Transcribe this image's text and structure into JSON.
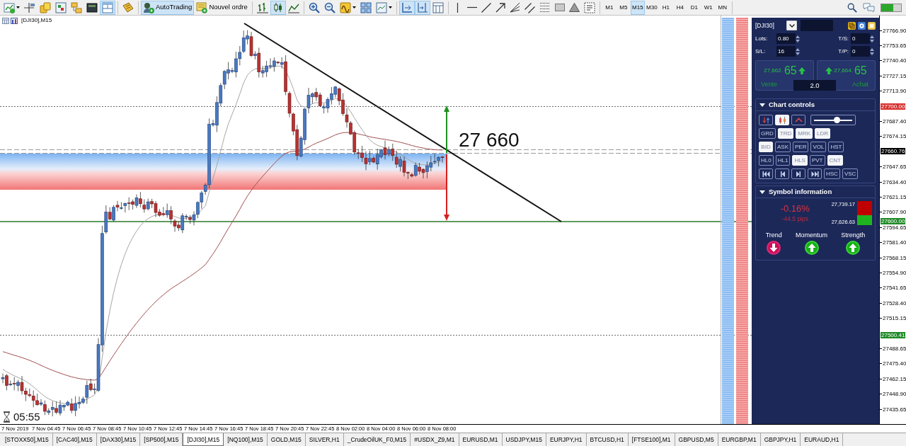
{
  "toolbar": {
    "tool_groups": [
      [
        {
          "kind": "newchart",
          "pressed": false,
          "dropdown": true
        },
        {
          "kind": "profiles",
          "pressed": false,
          "dropdown": false
        },
        {
          "kind": "marketwatch",
          "pressed": false,
          "dropdown": false
        },
        {
          "kind": "datawindow",
          "pressed": false,
          "dropdown": false
        },
        {
          "kind": "navigator",
          "pressed": false,
          "dropdown": false
        },
        {
          "kind": "terminal",
          "pressed": false,
          "dropdown": false
        },
        {
          "kind": "tester",
          "pressed": true,
          "dropdown": false
        }
      ],
      [
        {
          "kind": "scripts",
          "pressed": false,
          "dropdown": false
        }
      ],
      [
        {
          "kind": "autotrading",
          "label": "AutoTrading",
          "pressed": true,
          "dropdown": false
        },
        {
          "kind": "neworder",
          "label": "Nouvel ordre",
          "pressed": false,
          "dropdown": false
        }
      ],
      [
        {
          "kind": "bars",
          "pressed": false,
          "dropdown": false
        },
        {
          "kind": "candles",
          "pressed": true,
          "dropdown": false
        },
        {
          "kind": "line",
          "pressed": false,
          "dropdown": false
        }
      ],
      [
        {
          "kind": "zoomin",
          "pressed": false,
          "dropdown": false
        },
        {
          "kind": "zoomout",
          "pressed": false,
          "dropdown": false
        },
        {
          "kind": "indicators",
          "pressed": false,
          "dropdown": true
        },
        {
          "kind": "tile",
          "pressed": false,
          "dropdown": false
        },
        {
          "kind": "templates",
          "pressed": false,
          "dropdown": true
        }
      ],
      [
        {
          "kind": "autoscroll",
          "pressed": true,
          "dropdown": false
        },
        {
          "kind": "chartshift",
          "pressed": true,
          "dropdown": false
        },
        {
          "kind": "periods",
          "pressed": false,
          "dropdown": false
        }
      ],
      [
        {
          "kind": "vline",
          "pressed": false,
          "dropdown": false
        },
        {
          "kind": "hline",
          "pressed": false,
          "dropdown": false
        },
        {
          "kind": "trendline",
          "pressed": false,
          "dropdown": false
        },
        {
          "kind": "arrow",
          "pressed": false,
          "dropdown": false
        },
        {
          "kind": "fibo",
          "pressed": false,
          "dropdown": false
        },
        {
          "kind": "channel",
          "pressed": false,
          "dropdown": false
        },
        {
          "kind": "fibogrid",
          "pressed": false,
          "dropdown": false
        },
        {
          "kind": "rectangle",
          "pressed": false,
          "dropdown": false
        },
        {
          "kind": "triangle",
          "pressed": false,
          "dropdown": false
        },
        {
          "kind": "textlabel",
          "pressed": false,
          "dropdown": false
        }
      ]
    ],
    "timeframes": [
      {
        "label": "M1",
        "selected": false
      },
      {
        "label": "M5",
        "selected": false
      },
      {
        "label": "M15",
        "selected": true
      },
      {
        "label": "M30",
        "selected": false
      },
      {
        "label": "H1",
        "selected": false
      },
      {
        "label": "H4",
        "selected": false
      },
      {
        "label": "D1",
        "selected": false
      },
      {
        "label": "W1",
        "selected": false
      },
      {
        "label": "MN",
        "selected": false
      }
    ]
  },
  "chart": {
    "title": "[DJI30],M15",
    "annotation": "27 660",
    "timer": "05:55",
    "price_ticks": [
      "27766.90",
      "27753.65",
      "27740.40",
      "27727.15",
      "27713.90",
      "27687.40",
      "27674.15",
      "27647.65",
      "27634.40",
      "27621.15",
      "27607.90",
      "27594.65",
      "27581.40",
      "27568.15",
      "27554.90",
      "27541.65",
      "27528.40",
      "27515.15",
      "27488.65",
      "27475.40",
      "27462.15",
      "27448.90",
      "27435.65"
    ],
    "price_markers": [
      {
        "text": "27700.00",
        "color": "#d8312e"
      },
      {
        "text": "27660.76",
        "color": "#000000"
      },
      {
        "text": "27600.00",
        "color": "#1e8a26"
      },
      {
        "text": "27500.41",
        "color": "#1e8a26"
      }
    ],
    "time_labels": [
      "7 Nov 2019",
      "7 Nov 04:45",
      "7 Nov 06:45",
      "7 Nov 08:45",
      "7 Nov 10:45",
      "7 Nov 12:45",
      "7 Nov 14:45",
      "7 Nov 16:45",
      "7 Nov 18:45",
      "7 Nov 20:45",
      "7 Nov 22:45",
      "8 Nov 02:00",
      "8 Nov 04:00",
      "8 Nov 06:00",
      "8 Nov 08:00"
    ]
  },
  "trade_panel": {
    "symbol": "[DJI30]",
    "fields": [
      {
        "label": "Lots:",
        "value": "0.80"
      },
      {
        "label": "T/S:",
        "value": "0"
      },
      {
        "label": "S/L:",
        "value": "16"
      },
      {
        "label": "T/P:",
        "value": "0"
      }
    ],
    "sell": {
      "price": "27,662.",
      "pips": "65",
      "label": "Vente"
    },
    "buy": {
      "price": "27,664.",
      "pips": "65",
      "label": "Achat"
    },
    "spread": "2.0",
    "chart_controls": {
      "title": "Chart controls",
      "expanded": true,
      "icon_buttons": [
        {
          "kind": "arrows",
          "on": false
        },
        {
          "kind": "candles",
          "on": true
        },
        {
          "kind": "chevron",
          "on": false
        }
      ],
      "zoom_slider": {
        "level": 0.6
      },
      "button_rows": [
        [
          {
            "kind": "text",
            "label": "GRD",
            "on": false
          },
          {
            "kind": "text",
            "label": "TRD",
            "on": true
          },
          {
            "kind": "text",
            "label": "MRK",
            "on": true
          },
          {
            "kind": "text",
            "label": "LDR",
            "on": true
          }
        ],
        [
          {
            "kind": "text",
            "label": "BID",
            "on": true
          },
          {
            "kind": "text",
            "label": "ASK",
            "on": false
          },
          {
            "kind": "text",
            "label": "PER",
            "on": false
          },
          {
            "kind": "text",
            "label": "VOL",
            "on": false
          },
          {
            "kind": "text",
            "label": "HST",
            "on": false
          }
        ],
        [
          {
            "kind": "text",
            "label": "HL0",
            "on": false
          },
          {
            "kind": "text",
            "label": "HL1",
            "on": false
          },
          {
            "kind": "text",
            "label": "HLS",
            "on": true
          },
          {
            "kind": "text",
            "label": "PVT",
            "on": false
          },
          {
            "kind": "text",
            "label": "CNT",
            "on": true
          }
        ],
        [
          {
            "kind": "first",
            "on": false
          },
          {
            "kind": "prev",
            "on": false
          },
          {
            "kind": "next",
            "on": false
          },
          {
            "kind": "last",
            "on": false
          },
          {
            "kind": "text",
            "label": "HSC",
            "on": false
          },
          {
            "kind": "text",
            "label": "VSC",
            "on": false
          }
        ]
      ]
    },
    "symbol_info": {
      "title": "Symbol information",
      "expanded": true,
      "change": "-0.16%",
      "pips": "-44.5 pips",
      "high": "27,739.17",
      "low": "27,626.63",
      "range_bar": {
        "level": 0.4
      },
      "signals": [
        {
          "label": "Trend",
          "kind": "down"
        },
        {
          "label": "Momentum",
          "kind": "up"
        },
        {
          "label": "Strength",
          "kind": "up"
        }
      ]
    }
  },
  "tabs": [
    {
      "label": "[STOXX50],M15",
      "selected": false
    },
    {
      "label": "[CAC40],M15",
      "selected": false
    },
    {
      "label": "[DAX30],M15",
      "selected": false
    },
    {
      "label": "[SP500],M15",
      "selected": false
    },
    {
      "label": "[DJI30],M15",
      "selected": true
    },
    {
      "label": "[NQ100],M15",
      "selected": false
    },
    {
      "label": "GOLD,M15",
      "selected": false
    },
    {
      "label": "SILVER,H1",
      "selected": false
    },
    {
      "label": "_CrudeOilUK_F0,M15",
      "selected": false
    },
    {
      "label": "#USDX_Z9,M1",
      "selected": false
    },
    {
      "label": "EURUSD,M1",
      "selected": false
    },
    {
      "label": "USDJPY,M15",
      "selected": false
    },
    {
      "label": "EURJPY,H1",
      "selected": false
    },
    {
      "label": "BTCUSD,H1",
      "selected": false
    },
    {
      "label": "[FTSE100],M1",
      "selected": false
    },
    {
      "label": "GBPUSD,M5",
      "selected": false
    },
    {
      "label": "EURGBP,M1",
      "selected": false
    },
    {
      "label": "GBPJPY,H1",
      "selected": false
    },
    {
      "label": "EURAUD,H1",
      "selected": false
    }
  ]
}
